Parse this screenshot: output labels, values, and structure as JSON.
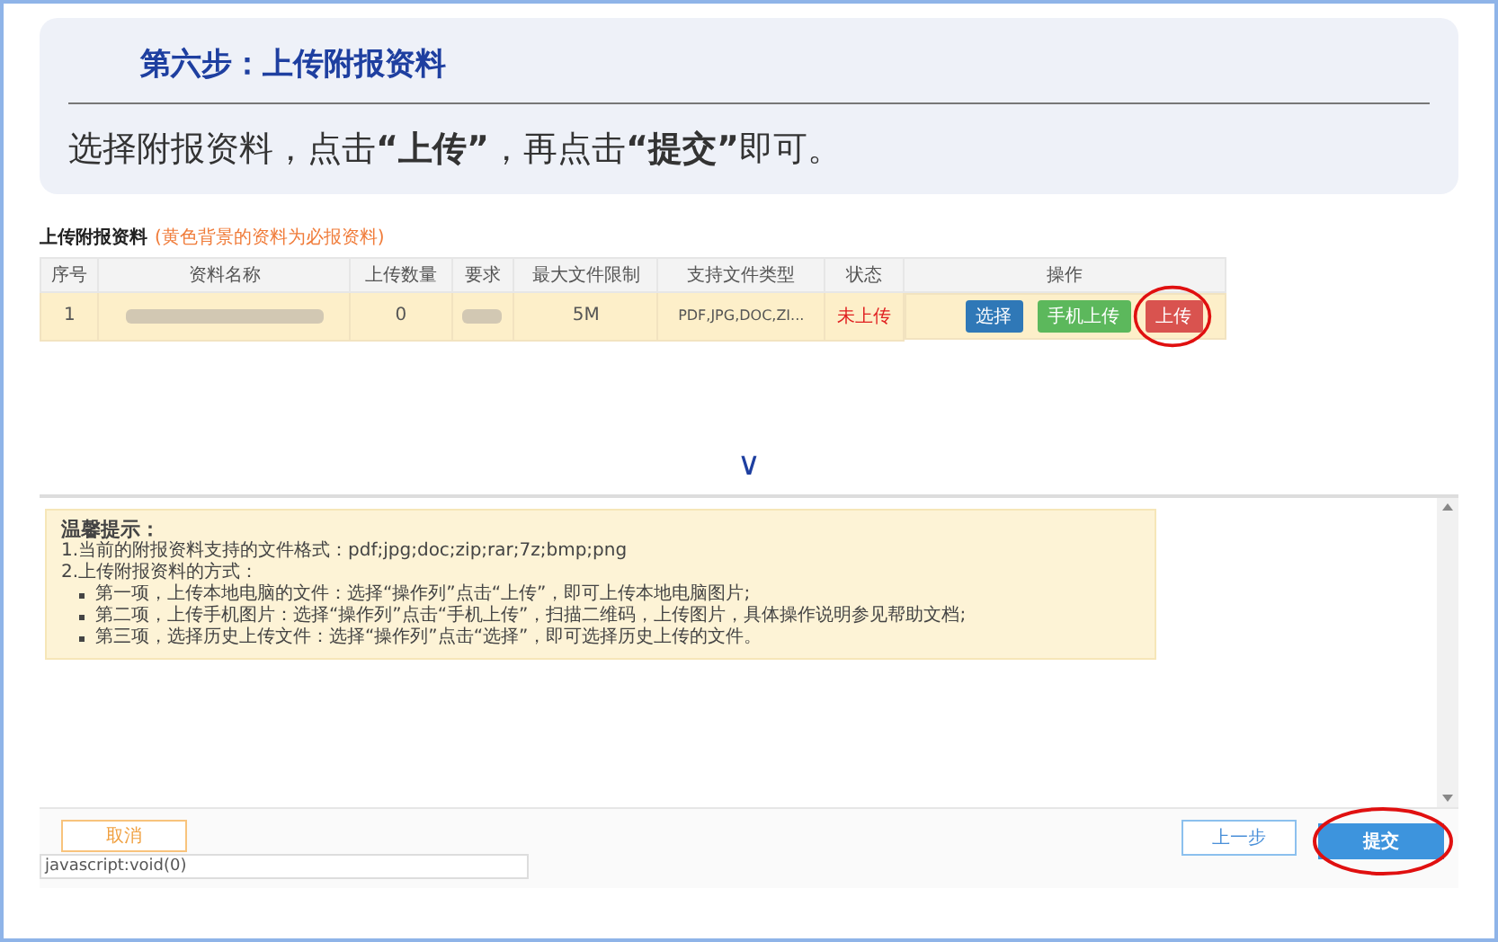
{
  "header": {
    "title": "第六步：上传附报资料",
    "instruction": "选择附报资料，点击**“上传”**，再点击**“提交”**即可。"
  },
  "upload_table": {
    "title": "上传附报资料",
    "note": "(黄色背景的资料为必报资料)",
    "columns": [
      "序号",
      "资料名称",
      "上传数量",
      "要求",
      "最大文件限制",
      "支持文件类型",
      "状态",
      "操作"
    ],
    "rows": [
      {
        "index": "1",
        "required": true,
        "count": "0",
        "max_size": "5M",
        "file_types": "PDF,JPG,DOC,ZI...",
        "status": "未上传",
        "actions": [
          {
            "label": "选择",
            "color": "#2f78b7"
          },
          {
            "label": "手机上传",
            "color": "#5cb85c"
          },
          {
            "label": "上传",
            "color": "#d9534f",
            "highlighted": true
          }
        ]
      }
    ]
  },
  "divider_glyph": "∨",
  "tips": {
    "title": "温馨提示：",
    "lines": [
      "1.当前的附报资料支持的文件格式：pdf;jpg;doc;zip;rar;7z;bmp;png",
      "2.上传附报资料的方式："
    ],
    "bullets": [
      "第一项，上传本地电脑的文件：选择“操作列”点击“上传”，即可上传本地电脑图片;",
      "第二项，上传手机图片：选择“操作列”点击“手机上传”，扫描二维码，上传图片，具体操作说明参见帮助文档;",
      "第三项，选择历史上传文件：选择“操作列”点击“选择”，即可选择历史上传的文件。"
    ]
  },
  "footer_buttons": [
    {
      "kind": "cancel",
      "label": "取消"
    },
    {
      "kind": "prev",
      "label": "上一步"
    },
    {
      "kind": "submit",
      "label": "提交",
      "highlighted": true
    }
  ],
  "status_bar": "javascript:void(0)"
}
